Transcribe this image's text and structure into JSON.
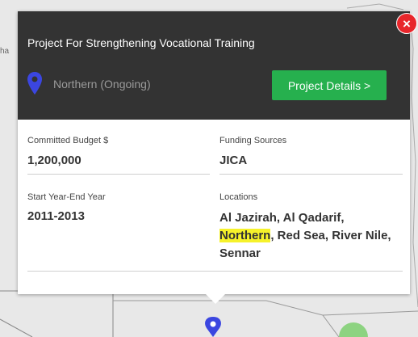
{
  "map": {
    "corner_label": "ha"
  },
  "popup": {
    "title": "Project For Strengthening Vocational Training",
    "status": "Northern (Ongoing)",
    "details_button": "Project Details >",
    "close_symbol": "×",
    "pin_icon": "location-pin-icon",
    "fields": {
      "committed_budget_label": "Committed Budget $",
      "committed_budget_value": "1,200,000",
      "funding_sources_label": "Funding Sources",
      "funding_sources_value": "JICA",
      "start_end_year_label": "Start Year-End Year",
      "start_end_year_value": "2011-2013",
      "locations_label": "Locations",
      "locations_before": "Al Jazirah, Al Qadarif,",
      "locations_highlight": "Northern",
      "locations_after": ", Red Sea, River Nile, Sennar"
    }
  },
  "colors": {
    "header_bg": "#333333",
    "button_green": "#26b04e",
    "close_red": "#e8262b",
    "pin_blue": "#3b46e0",
    "highlight_yellow": "#f6f22a"
  }
}
